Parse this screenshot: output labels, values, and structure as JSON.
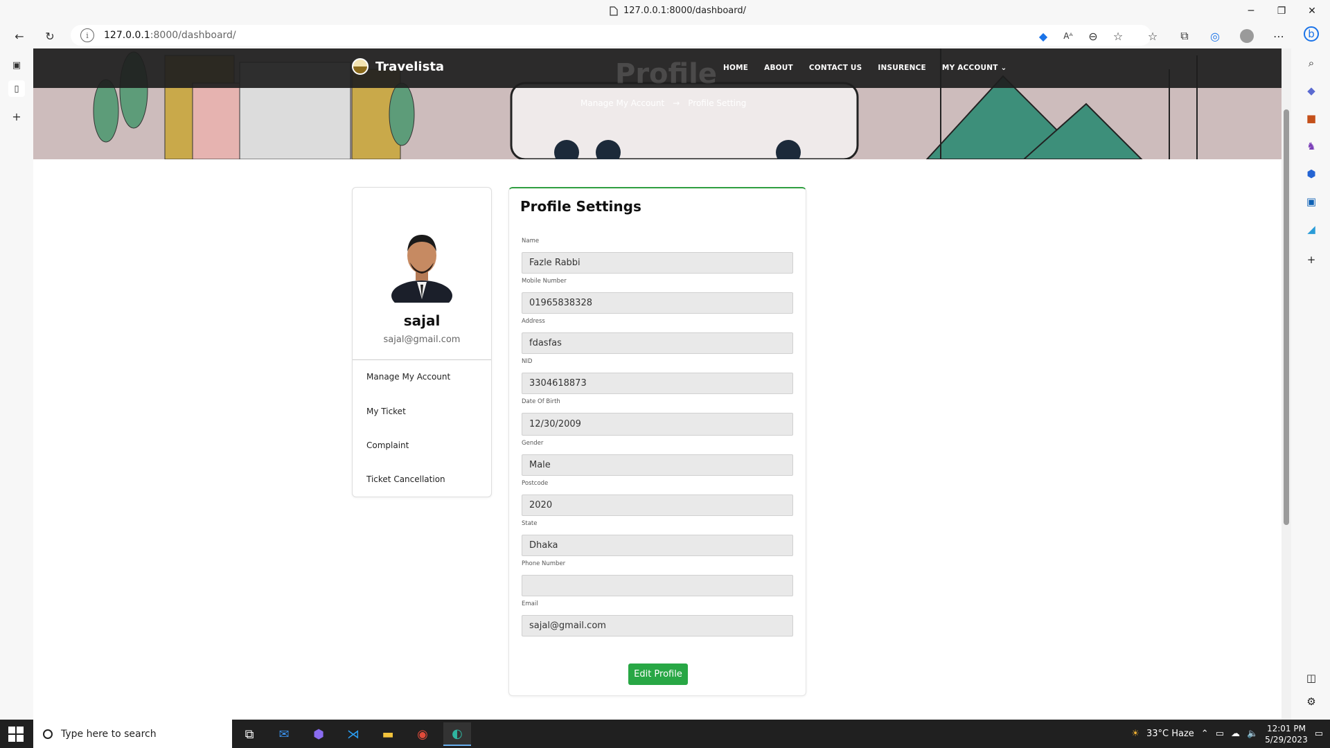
{
  "browser": {
    "tab_title": "127.0.0.1:8000/dashboard/",
    "url_host": "127.0.0.1",
    "url_rest": ":8000/dashboard/"
  },
  "site": {
    "brand": "Travelista",
    "nav": [
      "HOME",
      "ABOUT",
      "CONTACT US",
      "INSURENCE",
      "MY ACCOUNT"
    ],
    "hero_title": "Profile",
    "breadcrumb": {
      "first": "Manage My Account",
      "separator": "→",
      "current": "Profile Setting"
    }
  },
  "profile": {
    "name": "sajal",
    "email": "sajal@gmail.com",
    "menu": [
      "Manage My Account",
      "My Ticket",
      "Complaint",
      "Ticket Cancellation"
    ]
  },
  "settings": {
    "title": "Profile Settings",
    "fields": [
      {
        "label": "Name",
        "value": "Fazle Rabbi"
      },
      {
        "label": "Mobile Number",
        "value": "01965838328"
      },
      {
        "label": "Address",
        "value": "fdasfas"
      },
      {
        "label": "NID",
        "value": "3304618873"
      },
      {
        "label": "Date Of Birth",
        "value": "12/30/2009"
      },
      {
        "label": "Gender",
        "value": "Male"
      },
      {
        "label": "Postcode",
        "value": "2020"
      },
      {
        "label": "State",
        "value": "Dhaka"
      },
      {
        "label": "Phone Number",
        "value": ""
      },
      {
        "label": "Email",
        "value": "sajal@gmail.com"
      }
    ],
    "edit_button": "Edit Profile"
  },
  "taskbar": {
    "search_placeholder": "Type here to search",
    "weather": "33°C  Haze",
    "time": "12:01 PM",
    "date": "5/29/2023"
  },
  "colors": {
    "accent_green": "#28a745",
    "navbar": "#1e1e1e"
  }
}
